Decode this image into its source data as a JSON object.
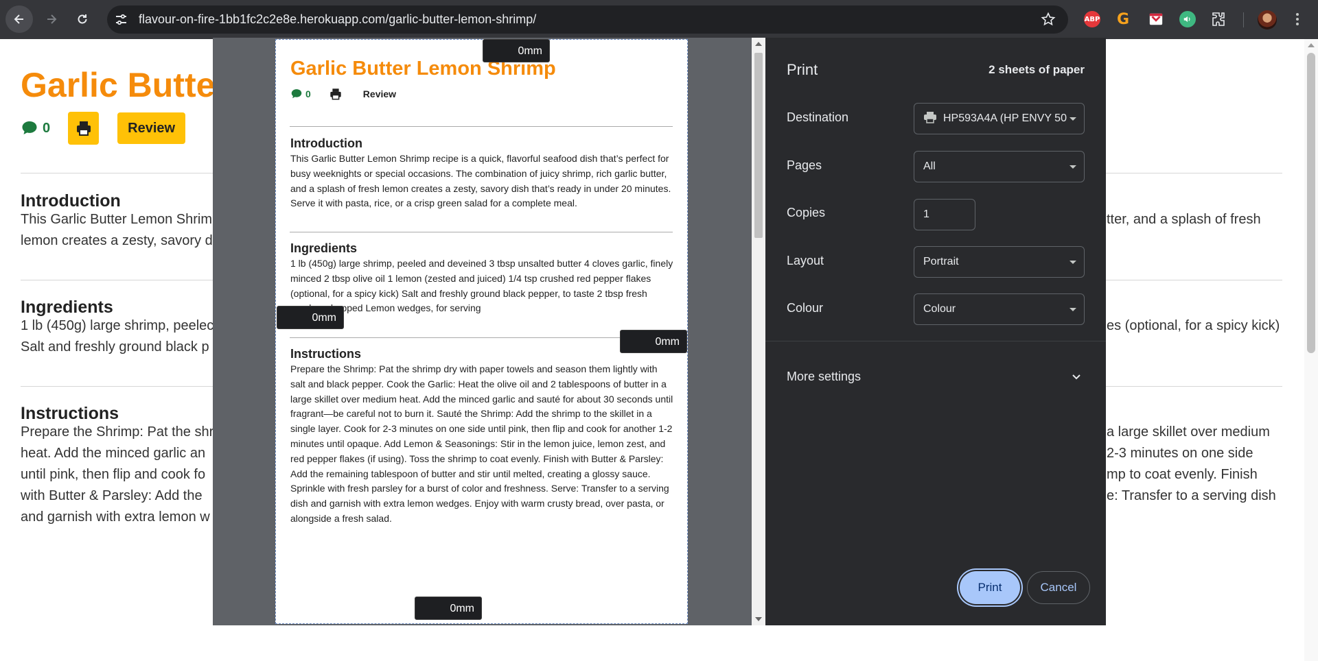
{
  "browser": {
    "url": "flavour-on-fire-1bb1fc2c2e8e.herokuapp.com/garlic-butter-lemon-shrimp/",
    "extensions": [
      "ABP",
      "G"
    ]
  },
  "page": {
    "title": "Garlic Butter",
    "comment_count": "0",
    "review_label": "Review",
    "sections": [
      {
        "heading": "Introduction",
        "left_lines": [
          "This Garlic Butter Lemon Shrim",
          "lemon creates a zesty, savory d"
        ],
        "right_lines": [
          "tter, and a splash of fresh"
        ]
      },
      {
        "heading": "Ingredients",
        "left_lines": [
          "1 lb (450g) large shrimp, peelec",
          "Salt and freshly ground black p"
        ],
        "right_lines": [
          "es (optional, for a spicy kick)"
        ]
      },
      {
        "heading": "Instructions",
        "left_lines": [
          "Prepare the Shrimp: Pat the shr",
          "heat. Add the minced garlic an",
          "until pink, then flip and cook fo",
          "with Butter & Parsley: Add the",
          "and garnish with extra lemon w"
        ],
        "right_lines": [
          "a large skillet over medium",
          "2-3 minutes on one side",
          "mp to coat evenly. Finish",
          "e: Transfer to a serving dish"
        ]
      }
    ]
  },
  "preview": {
    "title": "Garlic Butter Lemon Shrimp",
    "comment_count": "0",
    "review_label": "Review",
    "intro_heading": "Introduction",
    "intro_text": "This Garlic Butter Lemon Shrimp recipe is a quick, flavorful seafood dish that’s perfect for busy weeknights or special occasions. The combination of juicy shrimp, rich garlic butter, and a splash of fresh lemon creates a zesty, savory dish that’s ready in under 20 minutes. Serve it with pasta, rice, or a crisp green salad for a complete meal.",
    "ingredients_heading": "Ingredients",
    "ingredients_text": "1 lb (450g) large shrimp, peeled and deveined 3 tbsp unsalted butter 4 cloves garlic, finely minced 2 tbsp olive oil 1 lemon (zested and juiced) 1/4 tsp crushed red pepper flakes (optional, for a spicy kick) Salt and freshly ground black pepper, to taste 2 tbsp fresh parsley, chopped Lemon wedges, for serving",
    "instructions_heading": "Instructions",
    "instructions_text": "Prepare the Shrimp: Pat the shrimp dry with paper towels and season them lightly with salt and black pepper. Cook the Garlic: Heat the olive oil and 2 tablespoons of butter in a large skillet over medium heat. Add the minced garlic and sauté for about 30 seconds until fragrant—be careful not to burn it. Sauté the Shrimp: Add the shrimp to the skillet in a single layer. Cook for 2-3 minutes on one side until pink, then flip and cook for another 1-2 minutes until opaque. Add Lemon & Seasonings: Stir in the lemon juice, lemon zest, and red pepper flakes (if using). Toss the shrimp to coat evenly. Finish with Butter & Parsley: Add the remaining tablespoon of butter and stir until melted, creating a glossy sauce. Sprinkle with fresh parsley for a burst of color and freshness. Serve: Transfer to a serving dish and garnish with extra lemon wedges. Enjoy with warm crusty bread, over pasta, or alongside a fresh salad.",
    "margins": {
      "top": "0mm",
      "left": "0mm",
      "right": "0mm",
      "bottom": "0mm"
    }
  },
  "print_dialog": {
    "title": "Print",
    "sheets": "2 sheets of paper",
    "destination_label": "Destination",
    "destination_value": "HP593A4A (HP ENVY 50",
    "pages_label": "Pages",
    "pages_value": "All",
    "copies_label": "Copies",
    "copies_value": "1",
    "layout_label": "Layout",
    "layout_value": "Portrait",
    "colour_label": "Colour",
    "colour_value": "Colour",
    "more_settings_label": "More settings",
    "print_button": "Print",
    "cancel_button": "Cancel"
  },
  "colors": {
    "accent_orange": "#f58b0b",
    "button_yellow": "#ffc107",
    "comment_green": "#1d7a3e",
    "dialog_bg": "#292a2d",
    "print_button_blue": "#a8c7fa"
  }
}
